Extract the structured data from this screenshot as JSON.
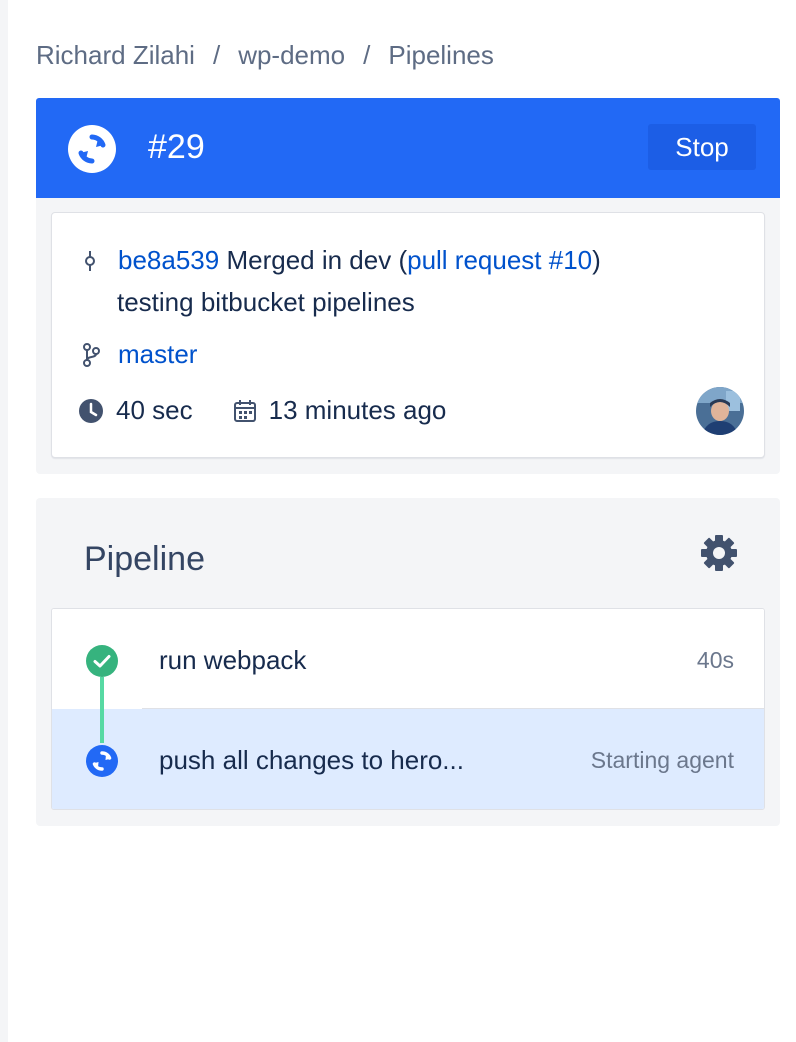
{
  "breadcrumb": {
    "user": "Richard Zilahi",
    "repo": "wp-demo",
    "page": "Pipelines",
    "separator": "/"
  },
  "build": {
    "number": "#29",
    "status_icon": "in-progress-icon",
    "stop_label": "Stop",
    "header_color": "#2269f5",
    "commit": {
      "hash": "be8a539",
      "message_prefix": " Merged in dev (",
      "pr_link": "pull request #10",
      "message_suffix": ")",
      "message_body": "testing bitbucket pipelines"
    },
    "branch": "master",
    "duration": "40 sec",
    "started": "13 minutes ago"
  },
  "pipeline": {
    "title": "Pipeline",
    "settings_icon": "gear-icon",
    "steps": [
      {
        "name": "run webpack",
        "status": "40s",
        "state": "success",
        "icon": "check-circle-icon"
      },
      {
        "name": "push all changes to hero...",
        "status": "Starting agent",
        "state": "in-progress",
        "icon": "in-progress-icon"
      }
    ]
  },
  "colors": {
    "accent": "#2269f5",
    "link": "#0052cc",
    "success": "#36b37e",
    "active_row": "#deebff"
  }
}
